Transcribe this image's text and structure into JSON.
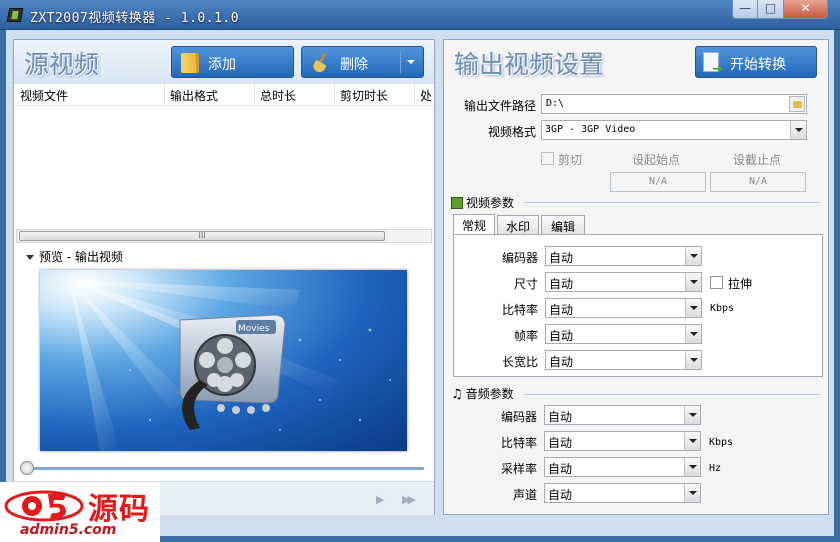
{
  "window": {
    "title": "ZXT2007视频转换器 - 1.0.1.0",
    "minimize": "—",
    "maximize": "□",
    "close": "✕"
  },
  "source": {
    "title": "源视频",
    "add_label": "添加",
    "delete_label": "删除",
    "columns": [
      "视频文件",
      "输出格式",
      "总时长",
      "剪切时长",
      "处"
    ],
    "scroll_grip": "III",
    "preview_label": "预览 - 输出视频",
    "preview_badge": "Movies",
    "play": "▶",
    "fast_forward": "▶▶"
  },
  "output": {
    "title": "输出视频设置",
    "start_label": "开始转换",
    "path_label": "输出文件路径",
    "path_value": "D:\\",
    "format_label": "视频格式",
    "format_value": "3GP - 3GP Video",
    "cut_label": "剪切",
    "set_start_label": "设起始点",
    "set_end_label": "设截止点",
    "start_value": "N/A",
    "end_value": "N/A"
  },
  "video_params": {
    "header": "视频参数",
    "tabs": [
      "常规",
      "水印",
      "编辑"
    ],
    "active_tab": "常规",
    "encoder_label": "编码器",
    "encoder_value": "自动",
    "size_label": "尺寸",
    "size_value": "自动",
    "stretch_label": "拉伸",
    "bitrate_label": "比特率",
    "bitrate_value": "自动",
    "bitrate_unit": "Kbps",
    "framerate_label": "帧率",
    "framerate_value": "自动",
    "aspect_label": "长宽比",
    "aspect_value": "自动"
  },
  "audio_params": {
    "header": "音频参数",
    "encoder_label": "编码器",
    "encoder_value": "自动",
    "bitrate_label": "比特率",
    "bitrate_value": "自动",
    "bitrate_unit": "Kbps",
    "samplerate_label": "采样率",
    "samplerate_value": "自动",
    "samplerate_unit": "Hz",
    "channel_label": "声道",
    "channel_value": "自动"
  },
  "watermark": {
    "brand": "源码",
    "url": "admin5.com"
  }
}
